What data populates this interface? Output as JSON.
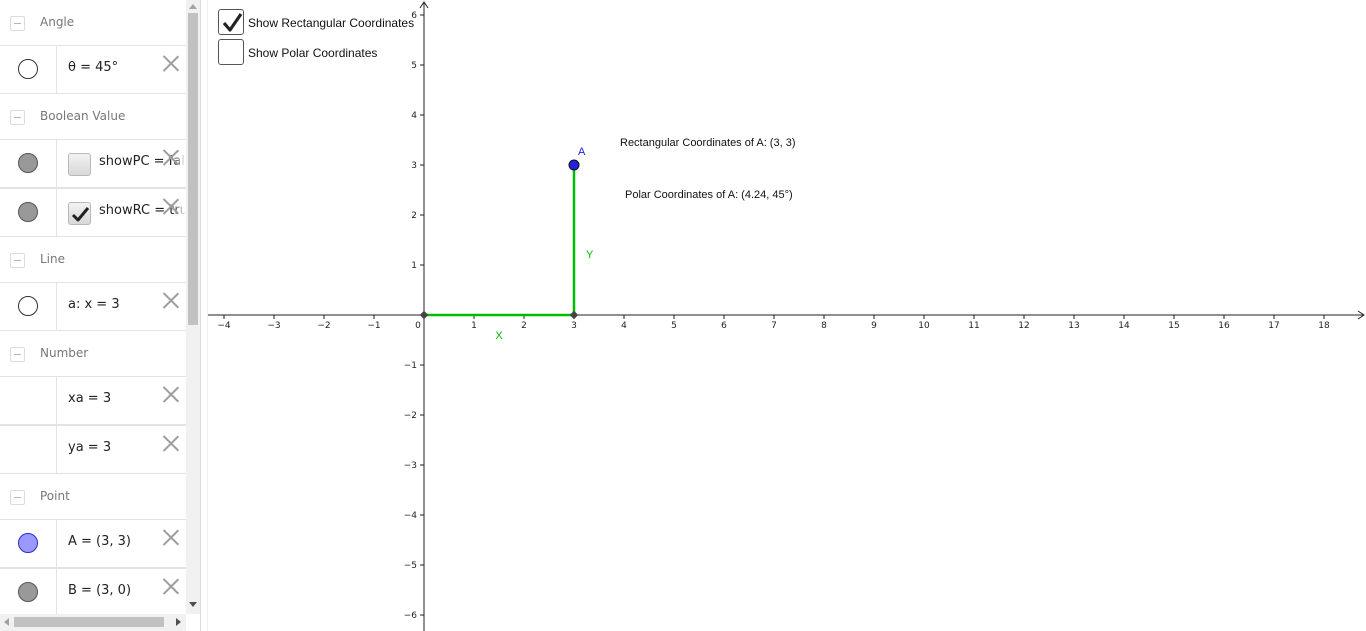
{
  "algebra": {
    "groups": [
      {
        "label": "Angle",
        "items": [
          {
            "expr": "θ = 45°",
            "marble": "white"
          }
        ]
      },
      {
        "label": "Boolean Value",
        "items": [
          {
            "expr": "showPC = false",
            "marble": "gray",
            "checkbox": false
          },
          {
            "expr": "showRC = true",
            "marble": "gray",
            "checkbox": true
          }
        ]
      },
      {
        "label": "Line",
        "items": [
          {
            "expr": "a: x = 3",
            "marble": "white"
          }
        ]
      },
      {
        "label": "Number",
        "items": [
          {
            "expr": "xa = 3",
            "marble": "none"
          },
          {
            "expr": "ya = 3",
            "marble": "none"
          }
        ]
      },
      {
        "label": "Point",
        "items": [
          {
            "expr": "A = (3, 3)",
            "marble": "blue"
          },
          {
            "expr": "B = (3, 0)",
            "marble": "gray"
          }
        ]
      }
    ]
  },
  "graphics": {
    "checkboxes": [
      {
        "label": "Show Rectangular Coordinates",
        "checked": true
      },
      {
        "label": "Show Polar Coordinates",
        "checked": false
      }
    ],
    "rect_text": "Rectangular Coordinates of A: (3, 3)",
    "polar_text": "Polar Coordinates of A: (4.24, 45°)",
    "point_label": "A",
    "segment_x_label": "X",
    "segment_y_label": "Y",
    "axes": {
      "x_range": [
        -4,
        18
      ],
      "y_range": [
        -6,
        6
      ],
      "x_ticks": [
        "−4",
        "−3",
        "−2",
        "−1",
        "0",
        "1",
        "2",
        "3",
        "4",
        "5",
        "6",
        "7",
        "8",
        "9",
        "10",
        "11",
        "12",
        "13",
        "14",
        "15",
        "16",
        "17",
        "18"
      ],
      "y_ticks": [
        "−6",
        "−5",
        "−4",
        "−3",
        "−2",
        "−1",
        "1",
        "2",
        "3",
        "4",
        "5",
        "6"
      ]
    },
    "point_A": {
      "x": 3,
      "y": 3
    },
    "point_B": {
      "x": 3,
      "y": 0
    },
    "origin": {
      "x": 0,
      "y": 0
    },
    "colors": {
      "segment": "#00bb00",
      "point": "#2222dd",
      "axis": "#222222"
    }
  }
}
